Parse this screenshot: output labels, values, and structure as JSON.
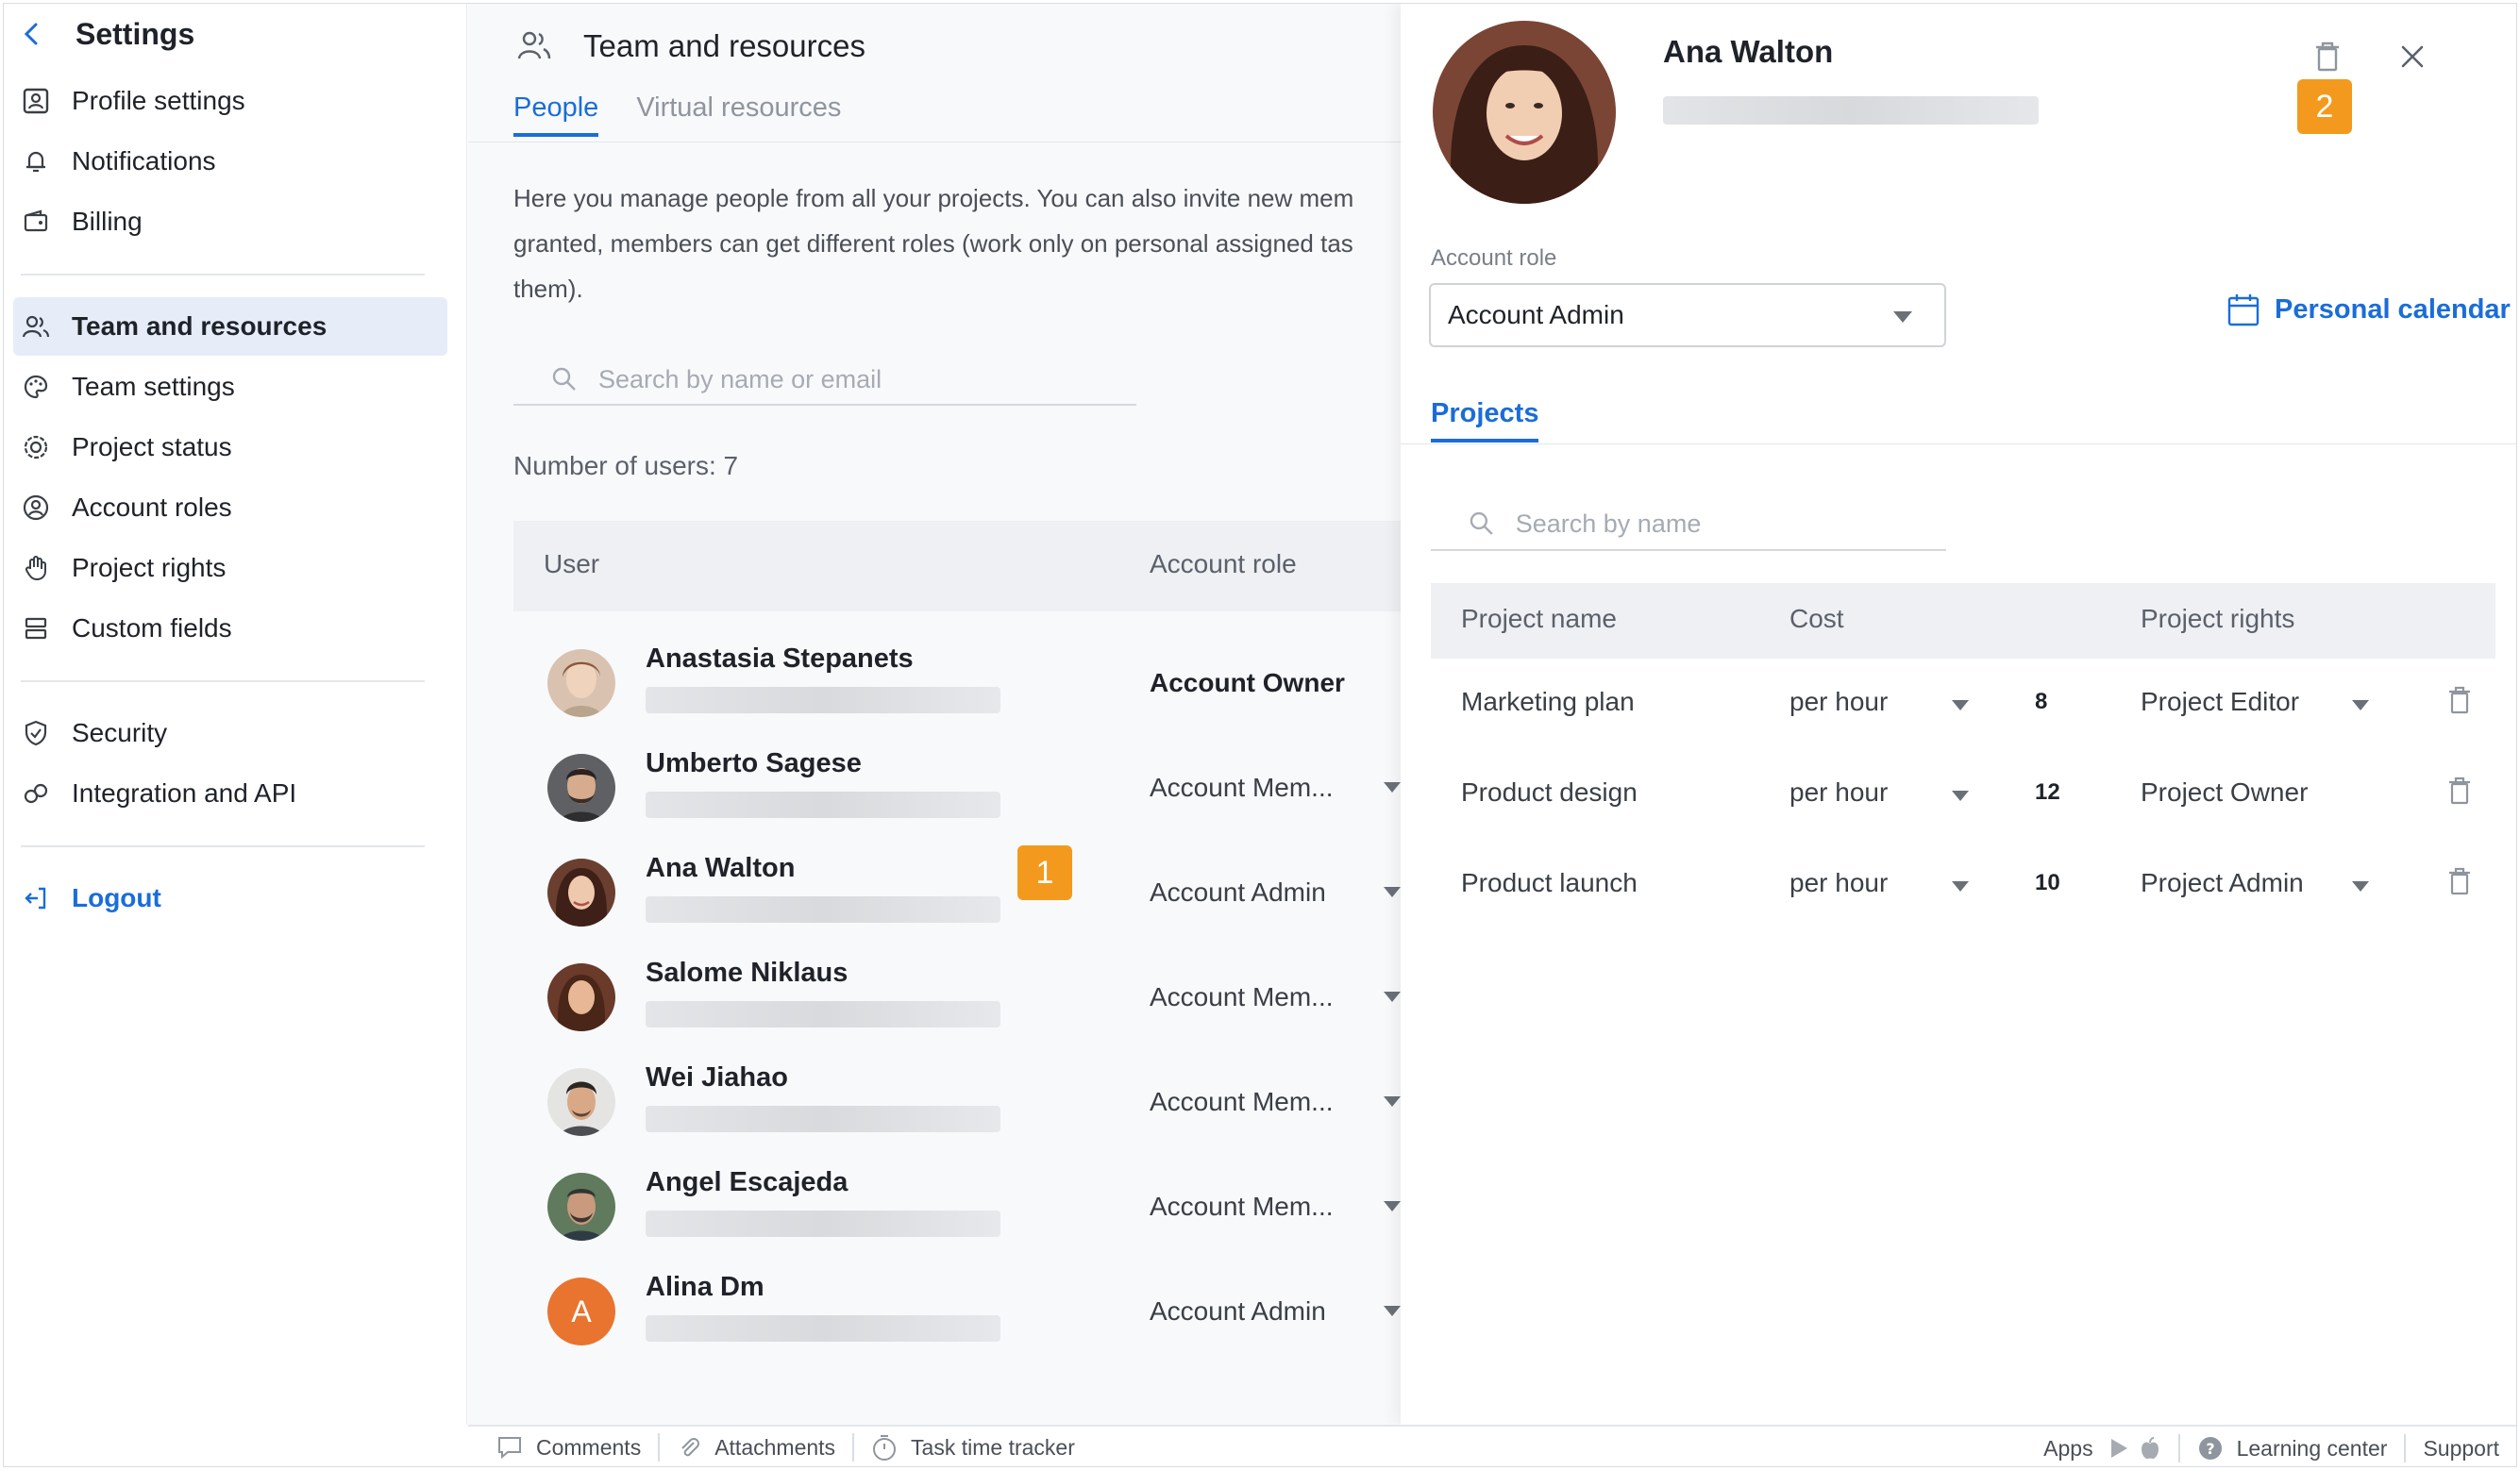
{
  "sidebar": {
    "title": "Settings",
    "items": [
      {
        "label": "Profile settings"
      },
      {
        "label": "Notifications"
      },
      {
        "label": "Billing"
      },
      {
        "label": "Team and resources"
      },
      {
        "label": "Team settings"
      },
      {
        "label": "Project status"
      },
      {
        "label": "Account roles"
      },
      {
        "label": "Project rights"
      },
      {
        "label": "Custom fields"
      },
      {
        "label": "Security"
      },
      {
        "label": "Integration and API"
      }
    ],
    "logout": "Logout"
  },
  "main": {
    "title": "Team and resources",
    "tabs": [
      "People",
      "Virtual resources"
    ],
    "description": "Here you manage people from all your projects. You can also invite new mem granted, members can get different roles (work only on personal assigned tas them).",
    "search_placeholder": "Search by name or email",
    "user_count": "Number of users: 7",
    "columns": {
      "user": "User",
      "role": "Account role"
    },
    "users": [
      {
        "name": "Anastasia Stepanets",
        "role": "Account Owner"
      },
      {
        "name": "Umberto Sagese",
        "role": "Account Mem..."
      },
      {
        "name": "Ana Walton",
        "role": "Account Admin"
      },
      {
        "name": "Salome Niklaus",
        "role": "Account Mem..."
      },
      {
        "name": "Wei Jiahao",
        "role": "Account Mem..."
      },
      {
        "name": "Angel Escajeda",
        "role": "Account Mem..."
      },
      {
        "name": "Alina Dm",
        "role": "Account Admin",
        "initial": "A"
      }
    ],
    "badge_1": "1"
  },
  "panel": {
    "name": "Ana Walton",
    "badge_2": "2",
    "role_label": "Account role",
    "role_value": "Account Admin",
    "calendar": "Personal calendar",
    "tab": "Projects",
    "search_placeholder": "Search by name",
    "columns": {
      "project": "Project name",
      "cost": "Cost",
      "rights": "Project rights"
    },
    "projects": [
      {
        "name": "Marketing plan",
        "cost": "per hour",
        "value": "8",
        "rights": "Project Editor"
      },
      {
        "name": "Product design",
        "cost": "per hour",
        "value": "12",
        "rights": "Project Owner"
      },
      {
        "name": "Product launch",
        "cost": "per hour",
        "value": "10",
        "rights": "Project Admin"
      }
    ]
  },
  "footer": {
    "comments": "Comments",
    "attachments": "Attachments",
    "tracker": "Task time tracker",
    "apps": "Apps",
    "learning": "Learning center",
    "support": "Support"
  },
  "colors": {
    "accent": "#1a6dd9",
    "badge": "#f39a1e",
    "active_bg": "#e6edf9",
    "avatar_orange": "#e8742f"
  }
}
